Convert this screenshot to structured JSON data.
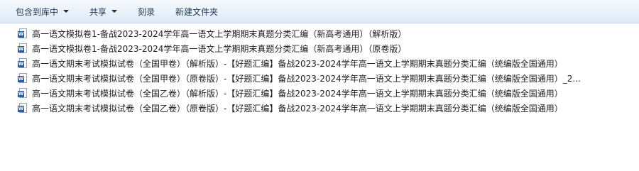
{
  "toolbar": {
    "include_in_library": "包含到库中",
    "share": "共享",
    "burn": "刻录",
    "new_folder": "新建文件夹"
  },
  "files": [
    {
      "name": "高一语文模拟卷1-备战2023-2024学年高一语文上学期期末真题分类汇编（新高考通用）（解析版）",
      "icon": "word-doc-icon"
    },
    {
      "name": "高一语文模拟卷1-备战2023-2024学年高一语文上学期期末真题分类汇编（新高考通用）（原卷版）",
      "icon": "word-doc-icon"
    },
    {
      "name": "高一语文期末考试模拟试卷（全国甲卷）（解析版）-【好题汇编】备战2023-2024学年高一语文上学期期末真题分类汇编（统编版全国通用）",
      "icon": "word-doc-icon"
    },
    {
      "name": "高一语文期末考试模拟试卷（全国甲卷）（原卷版）-【好题汇编】备战2023-2024学年高一语文上学期期末真题分类汇编（统编版全国通用）_2...",
      "icon": "word-doc-icon"
    },
    {
      "name": "高一语文期末考试模拟试卷（全国乙卷）（解析版）-【好题汇编】备战2023-2024学年高一语文上学期期末真题分类汇编（统编版全国通用）",
      "icon": "word-doc-icon"
    },
    {
      "name": "高一语文期末考试模拟试卷（全国乙卷）（原卷版）-【好题汇编】备战2023-2024学年高一语文上学期期末真题分类汇编（统编版全国通用）",
      "icon": "word-doc-icon"
    }
  ]
}
